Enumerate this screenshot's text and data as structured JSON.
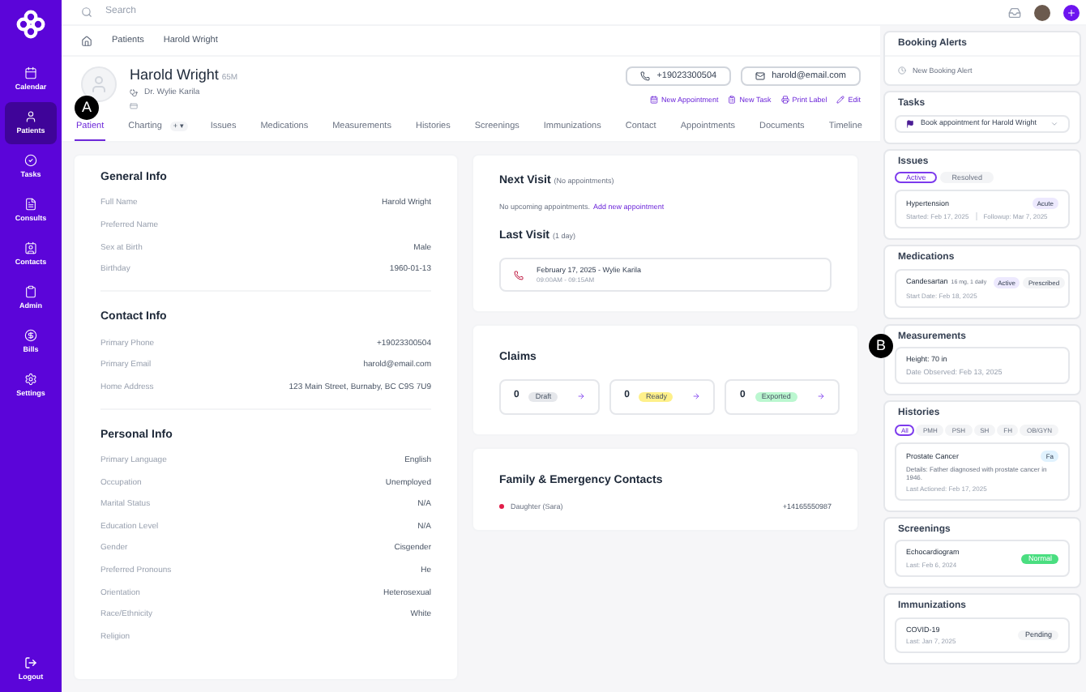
{
  "sidebar": {
    "items": [
      {
        "label": "Calendar",
        "selected": false
      },
      {
        "label": "Patients",
        "selected": true
      },
      {
        "label": "Tasks",
        "selected": false
      },
      {
        "label": "Consults",
        "selected": false
      },
      {
        "label": "Contacts",
        "selected": false
      },
      {
        "label": "Admin",
        "selected": false
      },
      {
        "label": "Bills",
        "selected": false
      },
      {
        "label": "Settings",
        "selected": false
      }
    ],
    "logout": "Logout"
  },
  "search": {
    "placeholder": "Search"
  },
  "breadcrumb": [
    "Patients",
    "Harold Wright"
  ],
  "patient": {
    "name": "Harold Wright",
    "age": "65M",
    "doctor": "Dr. Wylie Karila",
    "phone": "+19023300504",
    "email": "harold@email.com"
  },
  "actions": [
    "New Appointment",
    "New Task",
    "Print Label",
    "Edit"
  ],
  "tabs": [
    {
      "label": "Patient",
      "selected": true
    },
    {
      "label": "Charting",
      "selected": false,
      "kind": "menu",
      "menu": "+ ▾"
    },
    {
      "label": "Issues",
      "selected": false
    },
    {
      "label": "Medications",
      "selected": false
    },
    {
      "label": "Measurements",
      "selected": false
    },
    {
      "label": "Histories",
      "selected": false
    },
    {
      "label": "Screenings",
      "selected": false
    },
    {
      "label": "Immunizations",
      "selected": false
    },
    {
      "label": "Contact",
      "selected": false
    },
    {
      "label": "Appointments",
      "selected": false
    },
    {
      "label": "Documents",
      "selected": false
    },
    {
      "label": "Timeline",
      "selected": false
    }
  ],
  "info_sections": [
    {
      "title": "General Info",
      "rows": [
        {
          "label": "Full Name",
          "value": "Harold Wright"
        },
        {
          "label": "Preferred Name"
        },
        {
          "label": "Sex at Birth",
          "value": "Male"
        },
        {
          "label": "Birthday",
          "value": "1960-01-13"
        }
      ]
    },
    {
      "title": "Contact Info",
      "rows": [
        {
          "label": "Primary Phone",
          "value": "+19023300504"
        },
        {
          "label": "Primary Email",
          "value": "harold@email.com"
        },
        {
          "label": "Home Address",
          "value": "123 Main Street, Burnaby, BC C9S 7U9"
        }
      ]
    },
    {
      "title": "Personal Info",
      "rows": [
        {
          "label": "Primary Language",
          "value": "English"
        },
        {
          "label": "Occupation",
          "value": "Unemployed"
        },
        {
          "label": "Marital Status",
          "value": "N/A"
        },
        {
          "label": "Education Level",
          "value": "N/A"
        },
        {
          "label": "Gender",
          "value": "Cisgender"
        },
        {
          "label": "Preferred Pronouns",
          "value": "He"
        },
        {
          "label": "Orientation",
          "value": "Heterosexual"
        },
        {
          "label": "Race/Ethnicity",
          "value": "White"
        },
        {
          "label": "Religion"
        }
      ]
    }
  ],
  "next_visit": {
    "title": "Next Visit",
    "note": "(No appointments)",
    "text": "No upcoming appointments.",
    "link": "Add new appointment"
  },
  "last_visit": {
    "title": "Last Visit",
    "note": "(1 day)",
    "line1": "February 17, 2025 - Wylie Karila",
    "line2": "09:00AM - 09:15AM"
  },
  "claims": {
    "title": "Claims",
    "items": [
      {
        "count": "0",
        "label": "Draft",
        "color": "#e5e7eb"
      },
      {
        "count": "0",
        "label": "Ready",
        "color": "#fef08a"
      },
      {
        "count": "0",
        "label": "Exported",
        "color": "#bbf7d0"
      }
    ]
  },
  "contacts": {
    "title": "Family & Emergency Contacts",
    "items": [
      {
        "name": "Daughter (Sara)",
        "phone": "+14165550987"
      }
    ]
  },
  "booking_alerts": {
    "title": "Booking Alerts",
    "action": "New Booking Alert"
  },
  "tasks": {
    "title": "Tasks",
    "items": [
      {
        "text": "Book appointment for Harold Wright"
      }
    ]
  },
  "issues": {
    "title": "Issues",
    "filters": [
      {
        "label": "Active",
        "selected": true
      },
      {
        "label": "Resolved",
        "selected": false
      }
    ],
    "items": [
      {
        "name": "Hypertension",
        "badge": "Acute",
        "started": "Started: Feb 17, 2025",
        "followup": "Followup: Mar 7, 2025"
      }
    ]
  },
  "medications": {
    "title": "Medications",
    "items": [
      {
        "name": "Candesartan",
        "dose": "16 mg, 1 daily",
        "badges": [
          {
            "label": "Active",
            "color": "#ede9fe"
          },
          {
            "label": "Prescribed",
            "color": "#f3f4f6"
          }
        ],
        "start": "Start Date: Feb 18, 2025"
      }
    ]
  },
  "measurements": {
    "title": "Measurements",
    "lines": [
      "Height: 70 in",
      "Date Observed: Feb 13, 2025"
    ]
  },
  "histories": {
    "title": "Histories",
    "filters": [
      {
        "label": "All",
        "selected": true
      },
      {
        "label": "PMH",
        "selected": false
      },
      {
        "label": "PSH",
        "selected": false
      },
      {
        "label": "SH",
        "selected": false
      },
      {
        "label": "FH",
        "selected": false
      },
      {
        "label": "OB/GYN",
        "selected": false
      }
    ],
    "items": [
      {
        "name": "Prostate Cancer",
        "badge": "Fa",
        "details": "Details: Father diagnosed with prostate cancer in 1946.",
        "last": "Last Actioned: Feb 17, 2025"
      }
    ]
  },
  "screenings": {
    "title": "Screenings",
    "items": [
      {
        "name": "Echocardiogram",
        "last": "Last: Feb 6, 2024",
        "badge": "Normal",
        "color": "#4ade80"
      }
    ]
  },
  "immunizations": {
    "title": "Immunizations",
    "items": [
      {
        "name": "COVID-19",
        "last": "Last: Jan 7, 2025",
        "badge": "Pending",
        "color": "#f3f4f6"
      }
    ]
  },
  "markers": [
    "A",
    "B"
  ]
}
